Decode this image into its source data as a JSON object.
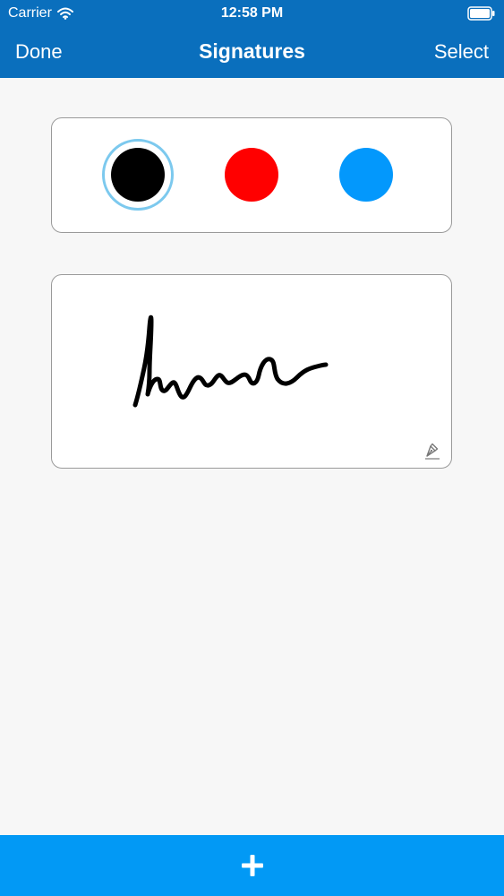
{
  "status_bar": {
    "carrier": "Carrier",
    "time": "12:58 PM",
    "wifi_icon": "wifi-icon",
    "battery_icon": "battery-icon"
  },
  "nav": {
    "left_label": "Done",
    "title": "Signatures",
    "right_label": "Select"
  },
  "color_picker": {
    "colors": [
      {
        "name": "black",
        "hex": "#000000",
        "selected": true
      },
      {
        "name": "red",
        "hex": "#ff0000",
        "selected": false
      },
      {
        "name": "blue",
        "hex": "#0398fc",
        "selected": false
      }
    ],
    "selection_ring_color": "#7cc9ee"
  },
  "signatures": [
    {
      "ink_color": "#000000",
      "edit_icon": "pen-icon"
    }
  ],
  "bottom_bar": {
    "add_icon": "plus-icon",
    "color": "#0299f5"
  },
  "theme": {
    "nav_background": "#0a6fbd",
    "page_background": "#f7f7f7"
  }
}
